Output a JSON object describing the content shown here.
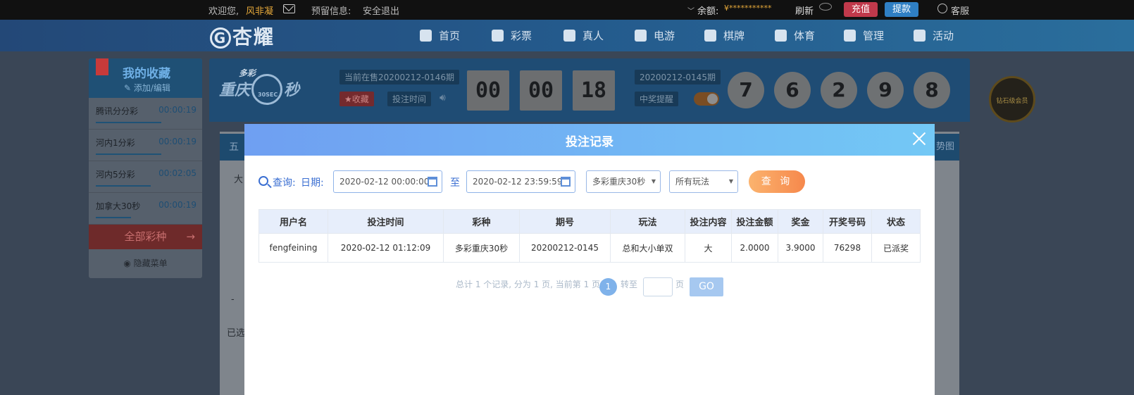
{
  "topbar": {
    "welcome": "欢迎您,",
    "username": "风非凝",
    "reserved_info": "预留信息:",
    "logout": "安全退出",
    "balance_label": "余额:",
    "balance_value": "¥***********",
    "refresh": "刷新",
    "deposit": "充值",
    "withdraw": "提款",
    "service": "客服",
    "colors": {
      "deposit": "#c0394b",
      "withdraw": "#2f7fc4"
    }
  },
  "nav": {
    "logo": "杏耀",
    "items": [
      {
        "label": "首页",
        "icon": "home-icon"
      },
      {
        "label": "彩票",
        "icon": "ticket-icon"
      },
      {
        "label": "真人",
        "icon": "person-icon"
      },
      {
        "label": "电游",
        "icon": "gamepad-icon"
      },
      {
        "label": "棋牌",
        "icon": "chess-icon"
      },
      {
        "label": "体育",
        "icon": "trophy-icon"
      },
      {
        "label": "管理",
        "icon": "users-icon"
      },
      {
        "label": "活动",
        "icon": "gift-icon"
      }
    ]
  },
  "favorites": {
    "title": "我的收藏",
    "edit": "添加/编辑",
    "items": [
      {
        "name": "腾讯分分彩",
        "time": "00:00:19",
        "progress": 0.65
      },
      {
        "name": "河内1分彩",
        "time": "00:00:19",
        "progress": 0.65
      },
      {
        "name": "河内5分彩",
        "time": "00:02:05",
        "progress": 0.55
      },
      {
        "name": "加拿大30秒",
        "time": "00:00:19",
        "progress": 0.35
      }
    ],
    "all_games": "全部彩种",
    "hide_menu": "隐藏菜单"
  },
  "game": {
    "logo_line1": "多彩",
    "logo_line2": "重庆",
    "logo_sub": "30SEC",
    "logo_sec": "秒",
    "current": "当前在售20200212-0146期",
    "favorite": "收藏",
    "bet_time": "投注时间",
    "countdown": [
      "00",
      "00",
      "18"
    ],
    "last_issue": "20200212-0145期",
    "win_remind": "中奖提醒",
    "balls": [
      "7",
      "6",
      "2",
      "9",
      "8"
    ]
  },
  "badge": {
    "text": "钻石级会员"
  },
  "background": {
    "tab_left": "五",
    "tab_right": "势图",
    "text_da": "大",
    "text_selected": "已选",
    "text_minus": "-"
  },
  "modal": {
    "title": "投注记录",
    "query_label": "查询:",
    "date_label": "日期:",
    "date_from": "2020-02-12 00:00:00",
    "to_label": "至",
    "date_to": "2020-02-12 23:59:59",
    "game_select": "多彩重庆30秒",
    "play_select": "所有玩法",
    "query_button": "查 询",
    "table": {
      "headers": [
        "用户名",
        "投注时间",
        "彩种",
        "期号",
        "玩法",
        "投注内容",
        "投注金额",
        "奖金",
        "开奖号码",
        "状态"
      ],
      "rows": [
        [
          "fengfeining",
          "2020-02-12 01:12:09",
          "多彩重庆30秒",
          "20200212-0145",
          "总和大小单双",
          "大",
          "2.0000",
          "3.9000",
          "76298",
          "已派奖"
        ]
      ]
    },
    "pager": {
      "summary": "总计 1 个记录, 分为 1 页, 当前第 1 页",
      "current": "1",
      "goto": "转至",
      "page": "页",
      "go": "GO"
    }
  }
}
